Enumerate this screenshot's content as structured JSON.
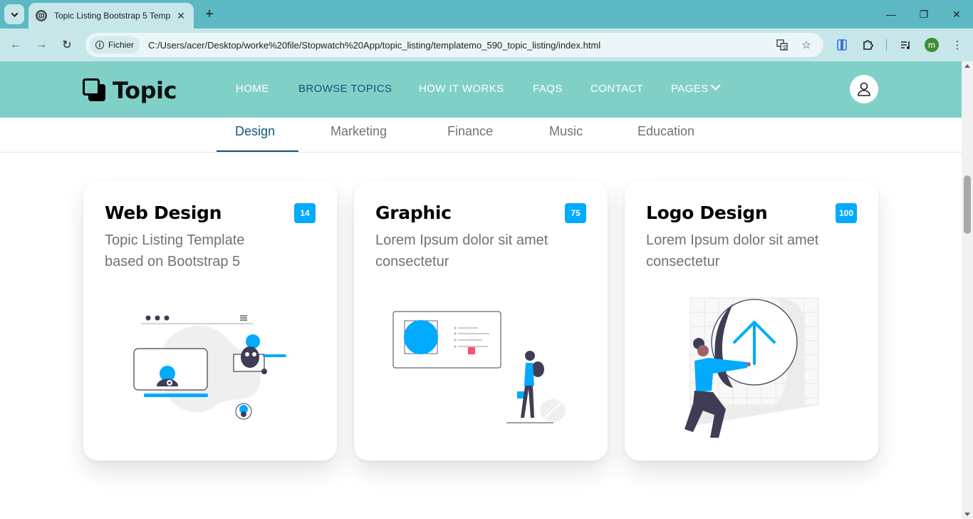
{
  "browser": {
    "tab_title": "Topic Listing Bootstrap 5 Temp",
    "url": "C:/Users/acer/Desktop/worke%20file/Stopwatch%20App/topic_listing/templatemo_590_topic_listing/index.html",
    "site_chip": "Fichier",
    "profile_initial": "m"
  },
  "nav": {
    "brand": "Topic",
    "items": [
      {
        "label": "HOME"
      },
      {
        "label": "BROWSE TOPICS"
      },
      {
        "label": "HOW IT WORKS"
      },
      {
        "label": "FAQS"
      },
      {
        "label": "CONTACT"
      },
      {
        "label": "PAGES"
      }
    ]
  },
  "tabs": [
    {
      "label": "Design"
    },
    {
      "label": "Marketing"
    },
    {
      "label": "Finance"
    },
    {
      "label": "Music"
    },
    {
      "label": "Education"
    }
  ],
  "cards": [
    {
      "title": "Web Design",
      "desc": "Topic Listing Template based on Bootstrap 5",
      "badge": "14"
    },
    {
      "title": "Graphic",
      "desc": "Lorem Ipsum dolor sit amet consectetur",
      "badge": "75"
    },
    {
      "title": "Logo Design",
      "desc": "Lorem Ipsum dolor sit amet consectetur",
      "badge": "100"
    }
  ],
  "colors": {
    "nav_bg": "#80d0c7",
    "accent": "#13547a",
    "badge": "#00aaff",
    "browser_frame": "#5cb8c3"
  }
}
